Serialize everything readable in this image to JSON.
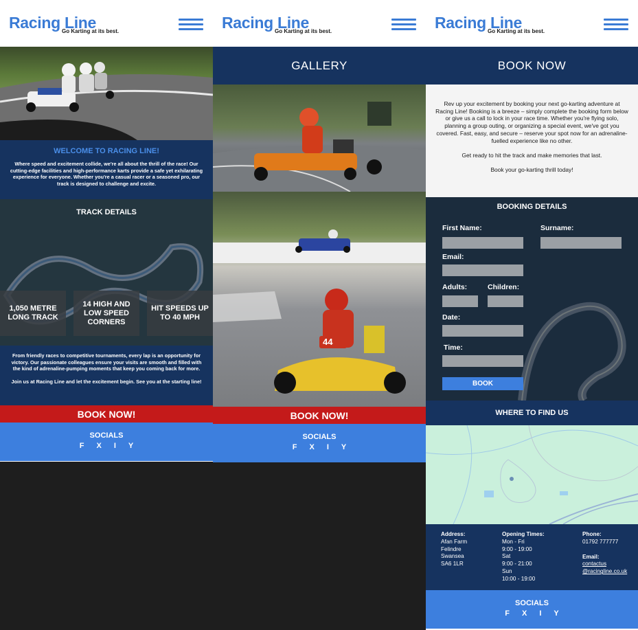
{
  "brand": {
    "name": "Racing Line",
    "tagline": "Go Karting at its best."
  },
  "home": {
    "welcome_title": "WELCOME TO RACING LINE!",
    "welcome_text": "Where speed and excitement collide, we're all about the thrill of the race! Our cutting-edge facilities and high-performance karts provide a safe yet exhilarating experience for everyone. Whether you're a casual racer or a seasoned pro, our track is designed to challenge and excite.",
    "track_title": "TRACK DETAILS",
    "stats": [
      "1,050 METRE LONG TRACK",
      "14 HIGH AND LOW SPEED CORNERS",
      "HIT SPEEDS UP TO 40 MPH"
    ],
    "track_text_1": "From friendly races to competitive tournaments, every lap is an opportunity for victory. Our passionate colleagues ensure your visits are smooth and filled with the kind of adrenaline-pumping moments that keep you coming back for more.",
    "track_text_2": "Join us at Racing Line and let the excitement begin. See you at the starting line!"
  },
  "cta": {
    "book_now": "BOOK NOW!"
  },
  "socials": {
    "title": "SOCIALS",
    "icons": [
      "F",
      "X",
      "I",
      "Y"
    ]
  },
  "gallery": {
    "title": "GALLERY",
    "kart_number": "44"
  },
  "book": {
    "title": "BOOK NOW",
    "intro_1": "Rev up your excitement by booking your next go-karting adventure at Racing Line! Booking is a breeze – simply complete the booking form below or give us a call to lock in your race time. Whether you're flying solo, planning a group outing, or organizing a special event, we've got you covered. Fast, easy, and secure – reserve your spot now for an adrenaline-fuelled experience like no other.",
    "intro_2": "Get ready to hit the track and make memories that last.",
    "intro_3": "Book your go-karting thrill today!",
    "form_title": "BOOKING DETAILS",
    "labels": {
      "first_name": "First Name:",
      "surname": "Surname:",
      "email": "Email:",
      "adults": "Adults:",
      "children": "Children:",
      "date": "Date:",
      "time": "Time:"
    },
    "submit": "BOOK"
  },
  "find": {
    "title": "WHERE TO FIND US",
    "address_label": "Address:",
    "address": [
      "Afan Farm",
      "Felindre",
      "Swansea",
      "SA6 1LR"
    ],
    "hours_label": "Opening Times:",
    "hours": [
      "Mon - Fri",
      "9:00 - 19:00",
      "Sat",
      "9:00 - 21:00",
      "Sun",
      "10:00 - 19:00"
    ],
    "phone_label": "Phone:",
    "phone": "01792 777777",
    "email_label": "Email:",
    "email": [
      "contactus",
      "@racingline.co.uk"
    ]
  },
  "colors": {
    "brand_blue": "#3a7bd5",
    "navy": "#16335f",
    "red": "#c41a1a",
    "social_blue": "#3d7fde"
  }
}
